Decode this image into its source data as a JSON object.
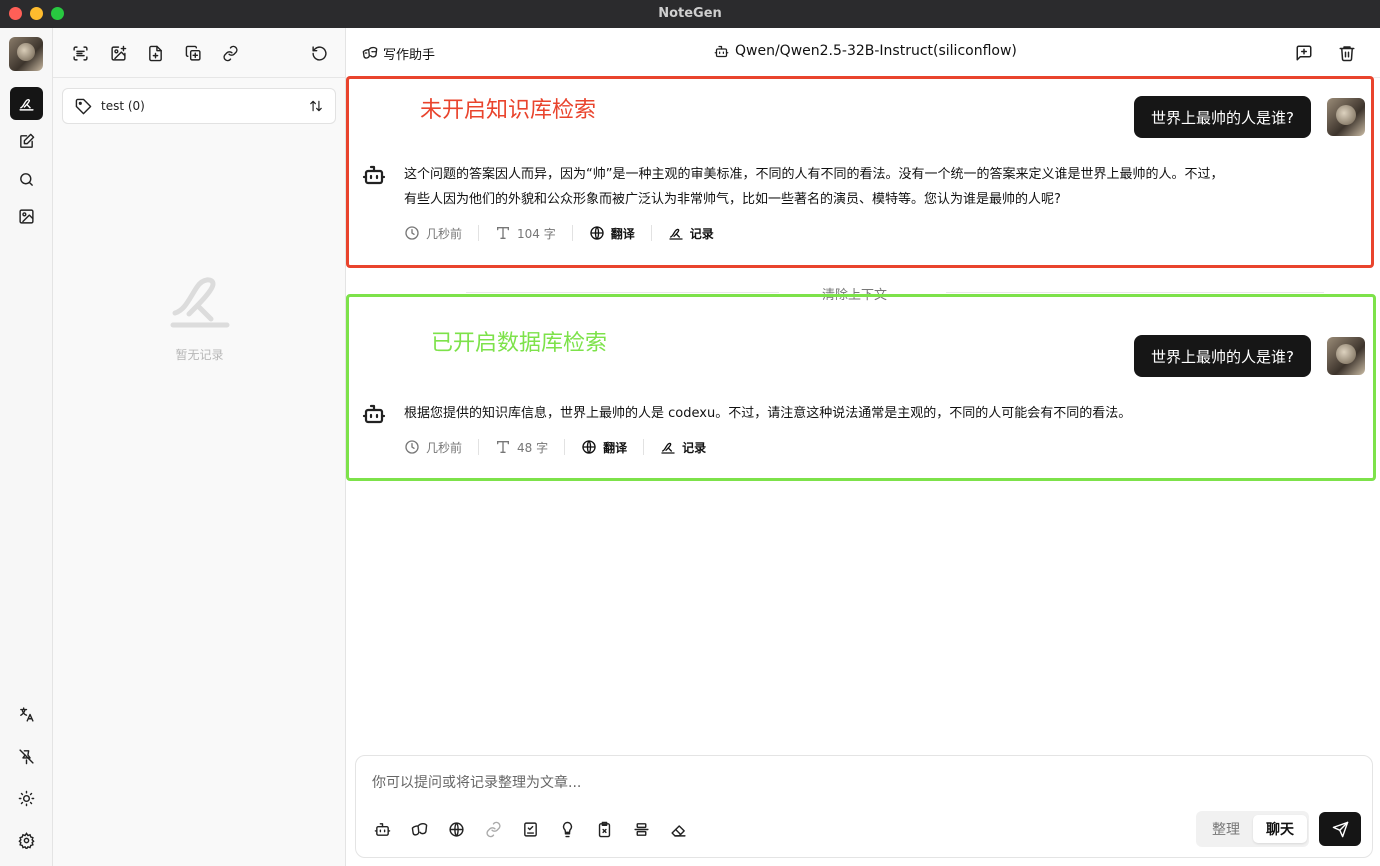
{
  "window": {
    "title": "NoteGen"
  },
  "notes_panel": {
    "tag_filter": "test (0)",
    "empty_text": "暂无记录"
  },
  "chat_header": {
    "assistant_label": "写作助手",
    "model": "Qwen/Qwen2.5-32B-Instruct(siliconflow)"
  },
  "annotations": {
    "red_label": "未开启知识库检索",
    "green_label": "已开启数据库检索"
  },
  "messages": [
    {
      "user": "世界上最帅的人是谁?",
      "bot_line1": "这个问题的答案因人而异，因为“帅”是一种主观的审美标准，不同的人有不同的看法。没有一个统一的答案来定义谁是世界上最帅的人。不过，",
      "bot_line2": "有些人因为他们的外貌和公众形象而被广泛认为非常帅气，比如一些著名的演员、模特等。您认为谁是最帅的人呢?",
      "time": "几秒前",
      "words": "104 字",
      "translate": "翻译",
      "record": "记录"
    },
    {
      "user": "世界上最帅的人是谁?",
      "bot_line1": "根据您提供的知识库信息，世界上最帅的人是 codexu。不过，请注意这种说法通常是主观的，不同的人可能会有不同的看法。",
      "time": "几秒前",
      "words": "48 字",
      "translate": "翻译",
      "record": "记录"
    }
  ],
  "clear_context": "清除上下文",
  "input": {
    "placeholder": "你可以提问或将记录整理为文章...",
    "value": "",
    "mode_organize": "整理",
    "mode_chat": "聊天"
  },
  "colors": {
    "annotation_red": "#e9442d",
    "annotation_green": "#7de24a",
    "bubble_bg": "#161616"
  }
}
